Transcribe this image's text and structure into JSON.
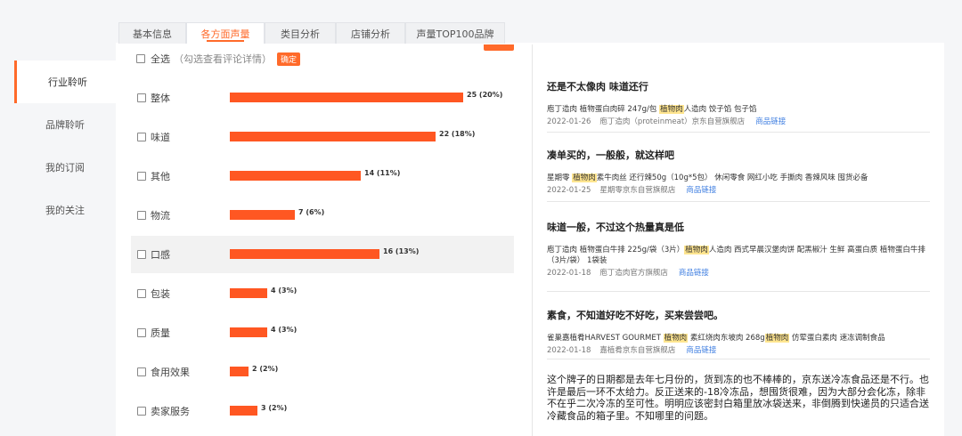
{
  "nav": {
    "items": [
      {
        "label": "行业聆听",
        "active": true
      },
      {
        "label": "品牌聆听",
        "active": false
      },
      {
        "label": "我的订阅",
        "active": false
      },
      {
        "label": "我的关注",
        "active": false
      }
    ]
  },
  "tabs": [
    {
      "label": "基本信息",
      "active": false
    },
    {
      "label": "各方面声量",
      "active": true
    },
    {
      "label": "类目分析",
      "active": false
    },
    {
      "label": "店铺分析",
      "active": false
    },
    {
      "label": "声量TOP100品牌",
      "active": false
    }
  ],
  "filter": {
    "select_all_label": "全选",
    "hint": "（勾选查看评论详情）",
    "confirm_label": "确定"
  },
  "chart_data": {
    "type": "bar",
    "orientation": "horizontal",
    "bar_color": "#ff5722",
    "categories": [
      "整体",
      "味道",
      "其他",
      "物流",
      "口感",
      "包装",
      "质量",
      "食用效果",
      "卖家服务"
    ],
    "values": [
      25,
      22,
      14,
      7,
      16,
      4,
      4,
      2,
      3
    ],
    "value_labels": [
      "25 (20%)",
      "22 (18%)",
      "14 (11%)",
      "7 (6%)",
      "16 (13%)",
      "4 (3%)",
      "4 (3%)",
      "2 (2%)",
      "3 (2%)"
    ],
    "highlighted_category": "口感"
  },
  "reviews": [
    {
      "title": "还是不太像肉 味道还行",
      "product_before": "庖丁造肉 植物蛋白肉碎 247g/包 ",
      "product_highlight": "植物肉",
      "product_after": "人造肉 饺子馅 包子馅",
      "date": "2022-01-26",
      "shop": "庖丁造肉（proteinmeat）京东自营旗舰店",
      "link": "商品链接"
    },
    {
      "title": "凑单买的，一般般，就这样吧",
      "product_before": "星期零 ",
      "product_highlight": "植物肉",
      "product_after": "素牛肉丝 还行辣50g（10g*5包） 休闲零食 网红小吃 手撕肉 香辣风味 囤货必备",
      "date": "2022-01-25",
      "shop": "星期零京东自营旗舰店",
      "link": "商品链接"
    },
    {
      "title": "味道一般，不过这个热量真是低",
      "product_before": "庖丁造肉 植物蛋白牛排 225g/袋（3片）",
      "product_highlight": "植物肉",
      "product_after": "人造肉 西式早晨汉堡肉饼 配黑椒汁 生鲜 高蛋白质 植物蛋白牛排（3片/袋） 1袋装",
      "date": "2022-01-18",
      "shop": "庖丁造肉官方旗舰店",
      "link": "商品链接"
    },
    {
      "title": "素食，不知道好吃不好吃，买来尝尝吧。",
      "product_before": "雀巢嘉植肴HARVEST GOURMET ",
      "product_highlight": "植物肉",
      "product_after": " 素红烧肉东坡肉 268g",
      "product_highlight2": "植物肉",
      "product_after2": " 仿荤蛋白素肉 速冻调制食品",
      "date": "2022-01-18",
      "shop": "嘉植肴京东自营旗舰店",
      "link": "商品链接"
    },
    {
      "title": "这个牌子的日期都是去年七月份的，货到冻的也不棒棒的，京东送冷冻食品还是不行。也许是最后一环不太给力。反正送来的-18冷冻品，想囤货很难，因为大部分会化冻，除非不在乎二次冷冻的至可性。明明应该密封白箱里放冰袋送来，非倒腾到快递员的只适合送冷藏食品的箱子里。不知哪里的问题。"
    }
  ]
}
